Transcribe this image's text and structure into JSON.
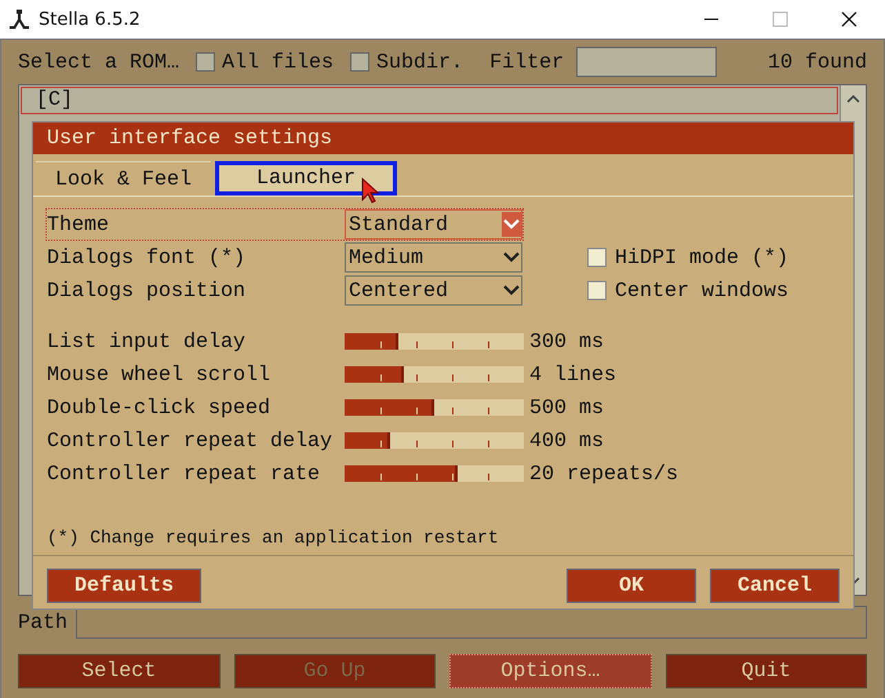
{
  "window": {
    "title": "Stella 6.5.2"
  },
  "launcher": {
    "heading": "Select a ROM…",
    "filters": [
      {
        "label": "All files",
        "checked": false
      },
      {
        "label": "Subdir.",
        "checked": false
      }
    ],
    "filter_label": "Filter",
    "found": "10 found",
    "list": [
      {
        "label": "[C]",
        "selected": true
      }
    ],
    "path_label": "Path",
    "buttons": [
      {
        "label": "Select",
        "disabled": false,
        "selected": false
      },
      {
        "label": "Go Up",
        "disabled": true,
        "selected": false
      },
      {
        "label": "Options…",
        "disabled": false,
        "selected": true
      },
      {
        "label": "Quit",
        "disabled": false,
        "selected": false
      }
    ]
  },
  "dialog": {
    "title": "User interface settings",
    "tabs": [
      {
        "label": "Look & Feel",
        "selected": false
      },
      {
        "label": "Launcher",
        "selected": true
      }
    ],
    "settings": [
      {
        "label": "Theme",
        "value": "Standard",
        "focused": true
      },
      {
        "label": "Dialogs font (*)",
        "value": "Medium",
        "focused": false,
        "checkbox": {
          "label": "HiDPI mode (*)",
          "checked": false
        }
      },
      {
        "label": "Dialogs position",
        "value": "Centered",
        "focused": false,
        "checkbox": {
          "label": "Center windows",
          "checked": false
        }
      }
    ],
    "sliders": [
      {
        "label": "List input delay",
        "level": 0.3,
        "reading": "300 ms"
      },
      {
        "label": "Mouse wheel scroll",
        "level": 0.33,
        "reading": "4 lines"
      },
      {
        "label": "Double-click speed",
        "level": 0.5,
        "reading": "500 ms"
      },
      {
        "label": "Controller repeat delay",
        "level": 0.25,
        "reading": "400 ms"
      },
      {
        "label": "Controller repeat rate",
        "level": 0.63,
        "reading": "20 repeats/s"
      }
    ],
    "note": "(*) Change requires an application restart",
    "buttons": [
      {
        "label": "Defaults"
      },
      {
        "label": "OK"
      },
      {
        "label": "Cancel"
      }
    ]
  }
}
